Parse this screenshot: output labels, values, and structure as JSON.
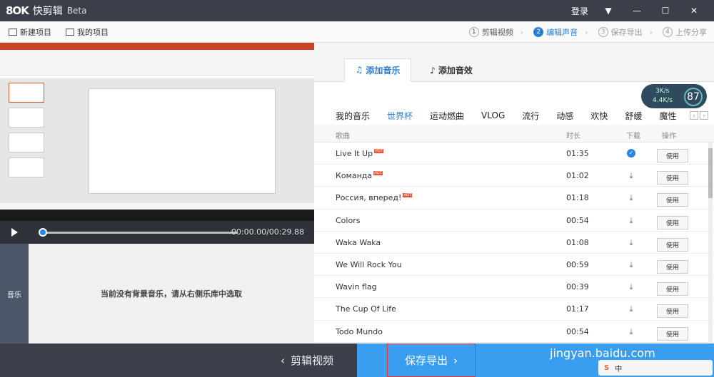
{
  "app": {
    "logo_mark": "8OK",
    "name": "快剪辑",
    "beta": "Beta",
    "login": "登录",
    "min": "—",
    "close": "✕"
  },
  "toolbar": {
    "new_project": "新建项目",
    "my_projects": "我的项目"
  },
  "steps": [
    {
      "num": "1",
      "label": "剪辑视频"
    },
    {
      "num": "2",
      "label": "编辑声音"
    },
    {
      "num": "3",
      "label": "保存导出"
    },
    {
      "num": "4",
      "label": "上传分享"
    }
  ],
  "player": {
    "time": "00:00.00/00:29.88"
  },
  "music_lane": {
    "label": "音乐",
    "empty_msg": "当前没有背景音乐，请从右侧乐库中选取"
  },
  "right": {
    "tab_music": "添加音乐",
    "tab_effects": "添加音效",
    "speed": {
      "up": "3K/s",
      "down": "4.4K/s",
      "percent": "87"
    },
    "categories": [
      "我的音乐",
      "世界杯",
      "运动燃曲",
      "VLOG",
      "流行",
      "动感",
      "欢快",
      "舒缓",
      "魔性"
    ],
    "selected_category": "世界杯",
    "columns": {
      "song": "歌曲",
      "duration": "时长",
      "download": "下载",
      "action": "操作"
    },
    "hot_badge": "HOT",
    "use_label": "使用",
    "songs": [
      {
        "title": "Live It Up",
        "hot": true,
        "duration": "01:35",
        "downloaded": true
      },
      {
        "title": "Команда",
        "hot": true,
        "duration": "01:02",
        "downloaded": false
      },
      {
        "title": "Россия, вперед!",
        "hot": true,
        "duration": "01:18",
        "downloaded": false
      },
      {
        "title": "Colors",
        "hot": false,
        "duration": "00:54",
        "downloaded": false
      },
      {
        "title": "Waka Waka",
        "hot": false,
        "duration": "01:08",
        "downloaded": false
      },
      {
        "title": "We Will Rock You",
        "hot": false,
        "duration": "00:59",
        "downloaded": false
      },
      {
        "title": "Wavin flag",
        "hot": false,
        "duration": "00:39",
        "downloaded": false
      },
      {
        "title": "The Cup Of Life",
        "hot": false,
        "duration": "01:17",
        "downloaded": false
      },
      {
        "title": "Todo Mundo",
        "hot": false,
        "duration": "00:54",
        "downloaded": false
      }
    ]
  },
  "bottom": {
    "edit_video": "剪辑视频",
    "save_export": "保存导出"
  },
  "watermark": "jingyan.baidu.com",
  "ime": {
    "s": "S",
    "lang": "中"
  },
  "colors": {
    "accent": "#2a7fd4",
    "titlebar": "#3a3f4a",
    "save_button": "#3a9ef0"
  }
}
